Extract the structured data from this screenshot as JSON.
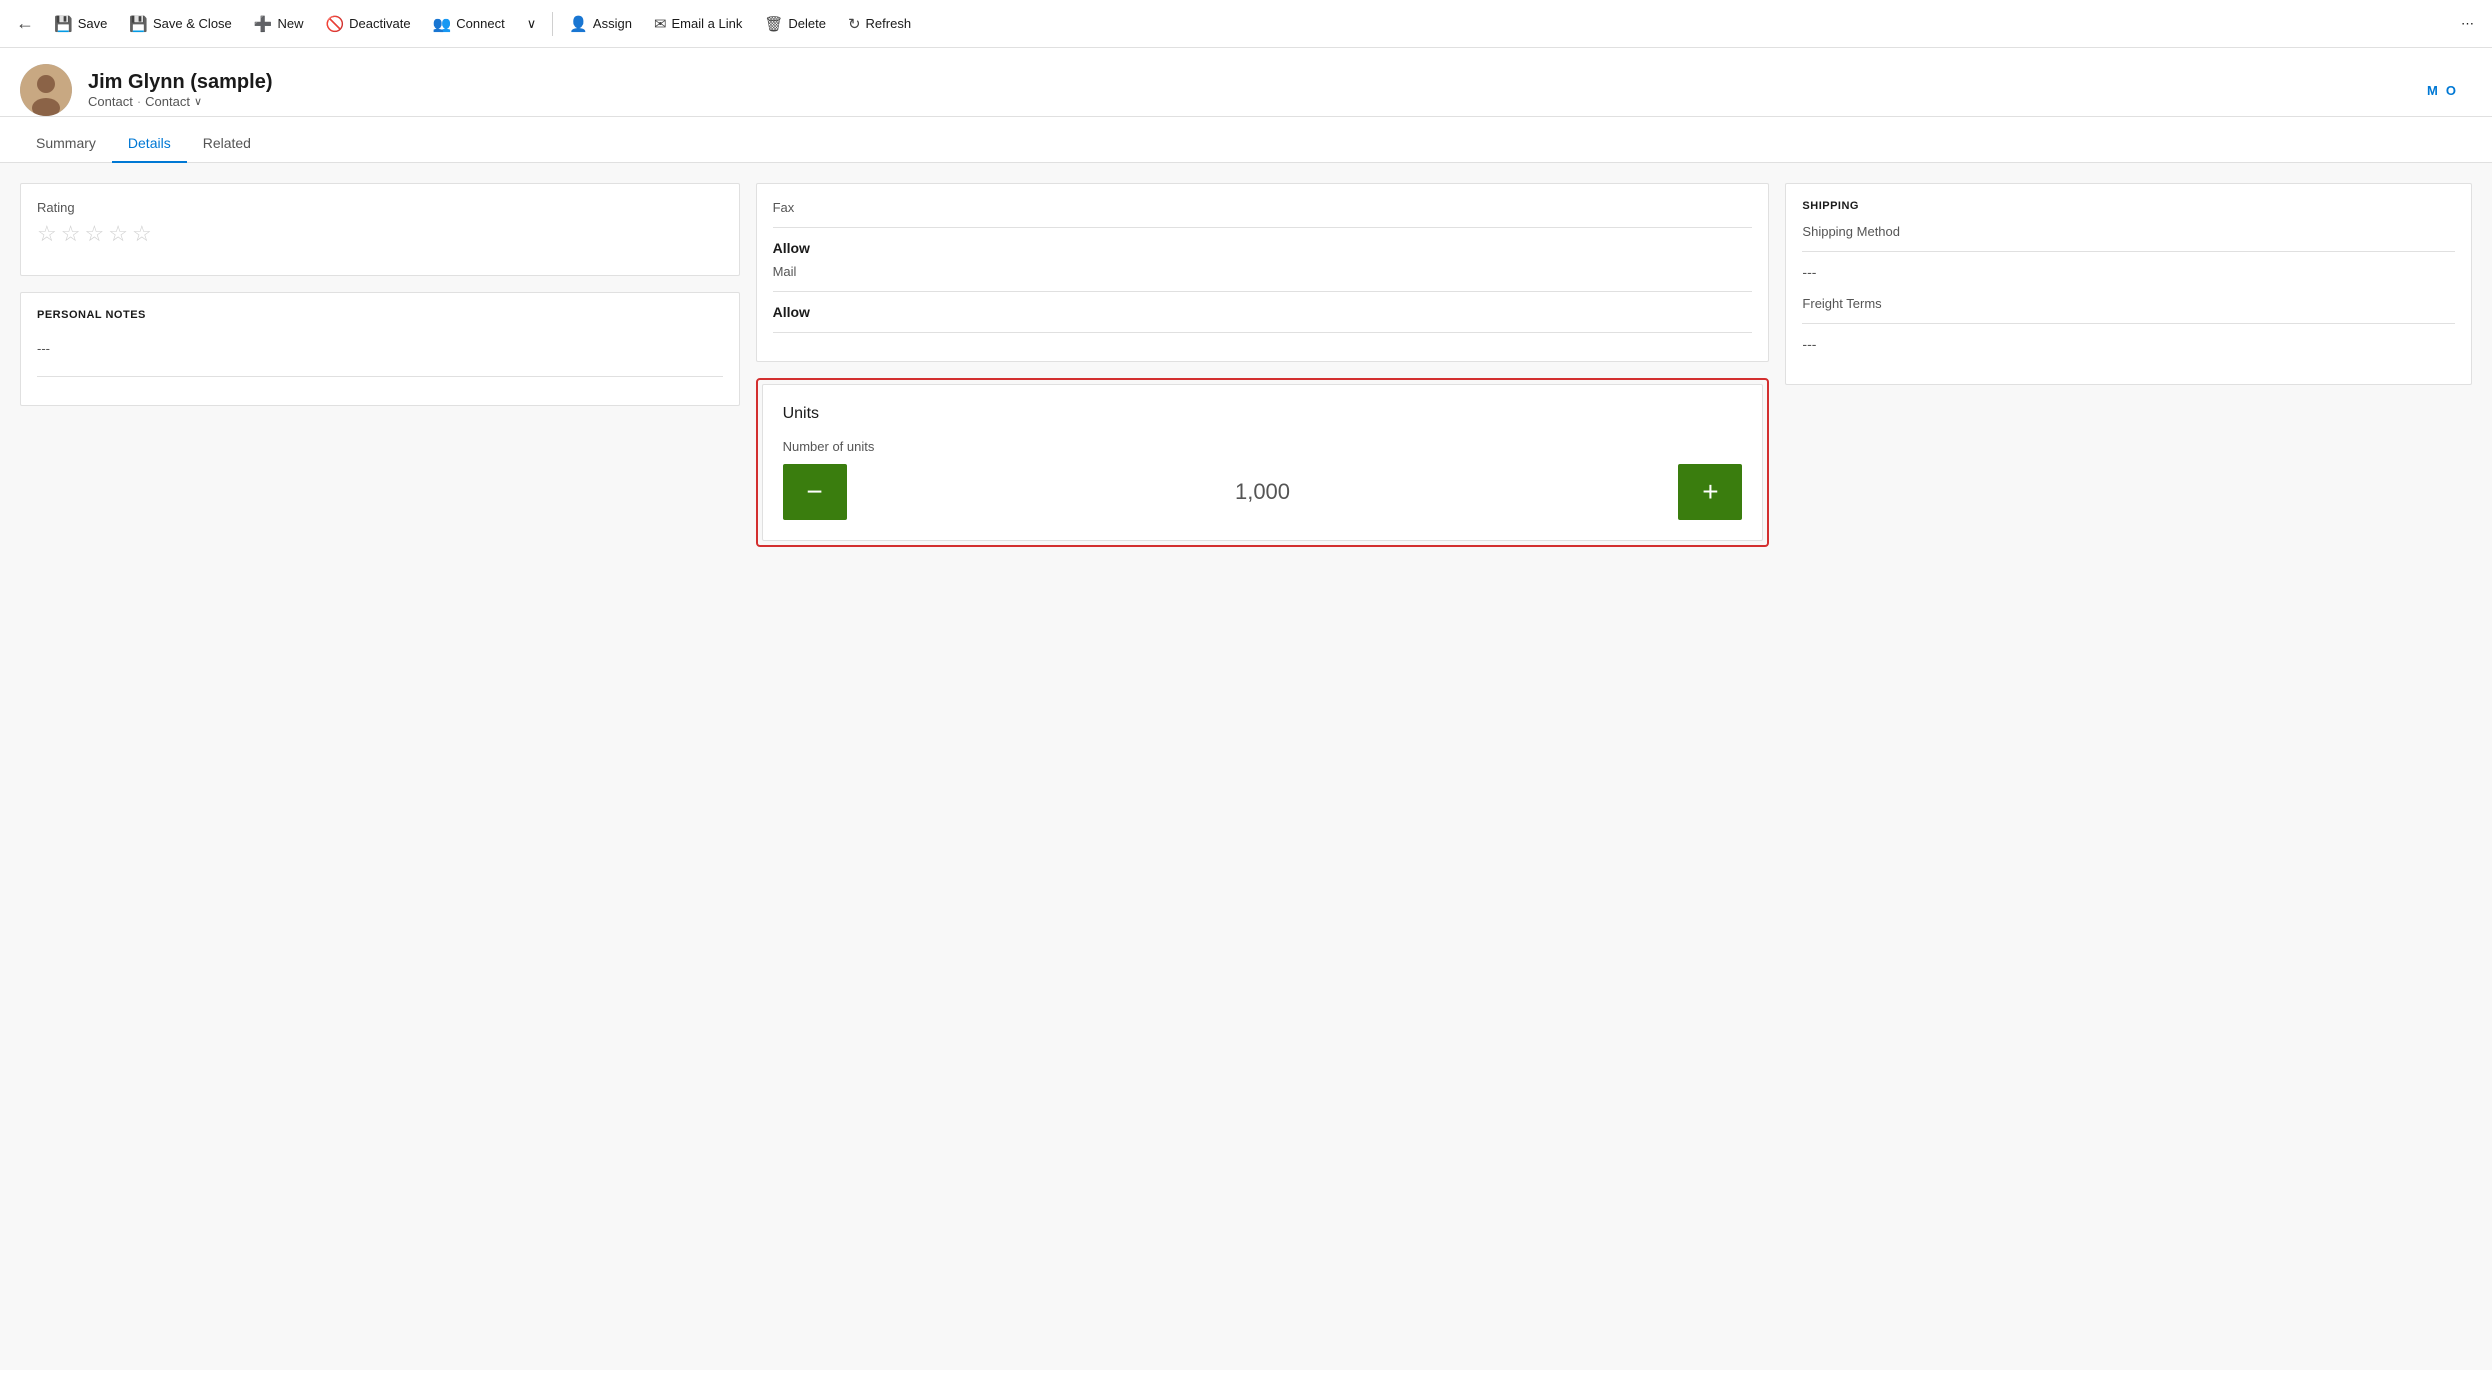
{
  "toolbar": {
    "back_icon": "←",
    "save_label": "Save",
    "save_close_label": "Save & Close",
    "new_label": "New",
    "deactivate_label": "Deactivate",
    "connect_label": "Connect",
    "assign_label": "Assign",
    "email_link_label": "Email a Link",
    "delete_label": "Delete",
    "refresh_label": "Refresh",
    "more_icon": "⋯"
  },
  "record": {
    "name": "Jim Glynn (sample)",
    "type1": "Contact",
    "dot": "·",
    "type2": "Contact",
    "dropdown_arrow": "∨",
    "header_right_initial": "M",
    "header_right_label2": "O"
  },
  "tabs": [
    {
      "id": "summary",
      "label": "Summary",
      "active": false
    },
    {
      "id": "details",
      "label": "Details",
      "active": true
    },
    {
      "id": "related",
      "label": "Related",
      "active": false
    }
  ],
  "left_column": {
    "rating_section": {
      "field_label": "Rating",
      "stars": [
        "☆",
        "☆",
        "☆",
        "☆",
        "☆"
      ]
    },
    "personal_notes": {
      "title": "PERSONAL NOTES",
      "value": "---"
    }
  },
  "center_column": {
    "contact_info": {
      "fax_label": "Fax",
      "fax_value": "Allow",
      "mail_label": "Mail",
      "mail_value": "Allow"
    },
    "units": {
      "title": "Units",
      "field_label": "Number of units",
      "value": "1,000",
      "minus_label": "−",
      "plus_label": "+"
    }
  },
  "right_column": {
    "shipping": {
      "title": "SHIPPING",
      "method_label": "Shipping Method",
      "method_value": "---",
      "freight_label": "Freight Terms",
      "freight_value": "---"
    }
  }
}
